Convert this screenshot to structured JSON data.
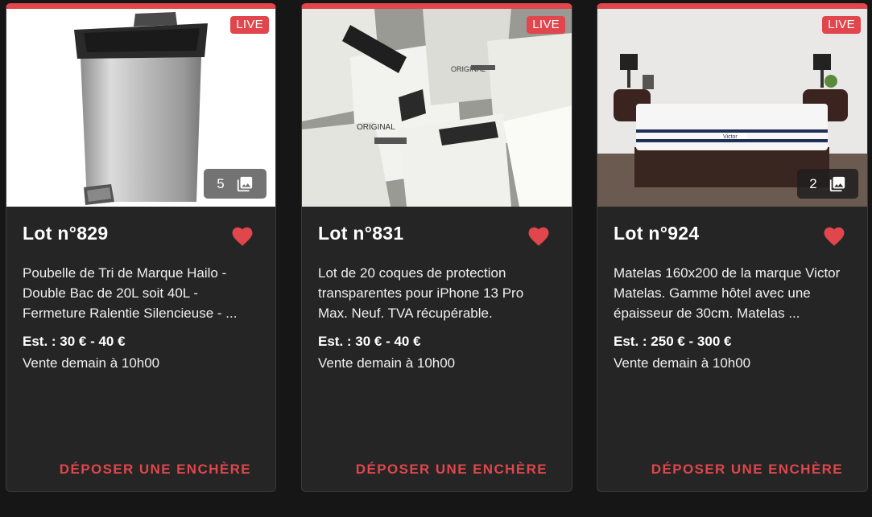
{
  "colors": {
    "accent": "#e0464b",
    "card_background": "#252525",
    "page_background": "#161616"
  },
  "icons": [
    "photo-library-icon",
    "heart-icon"
  ],
  "lots": [
    {
      "live_badge": "LIVE",
      "image_count": "5",
      "title": "Lot n°829",
      "description": "Poubelle de Tri de Marque Hailo - Double Bac de 20L soit 40L - Fermeture Ralentie Silencieuse - ...",
      "estimate": "Est. : 30 € - 40 €",
      "sale_time": "Vente demain à 10h00",
      "bid_button": "DÉPOSER UNE ENCHÈRE"
    },
    {
      "live_badge": "LIVE",
      "title": "Lot n°831",
      "description": "Lot de 20 coques de protection transparentes pour iPhone 13 Pro Max. Neuf. TVA récupérable.",
      "estimate": "Est. : 30 € - 40 €",
      "sale_time": "Vente demain à 10h00",
      "bid_button": "DÉPOSER UNE ENCHÈRE"
    },
    {
      "live_badge": "LIVE",
      "image_count": "2",
      "title": "Lot n°924",
      "description": "Matelas 160x200 de la marque Victor Matelas. Gamme hôtel avec une épaisseur de 30cm. Matelas ...",
      "estimate": "Est. : 250 € - 300 €",
      "sale_time": "Vente demain à 10h00",
      "bid_button": "DÉPOSER UNE ENCHÈRE"
    }
  ]
}
